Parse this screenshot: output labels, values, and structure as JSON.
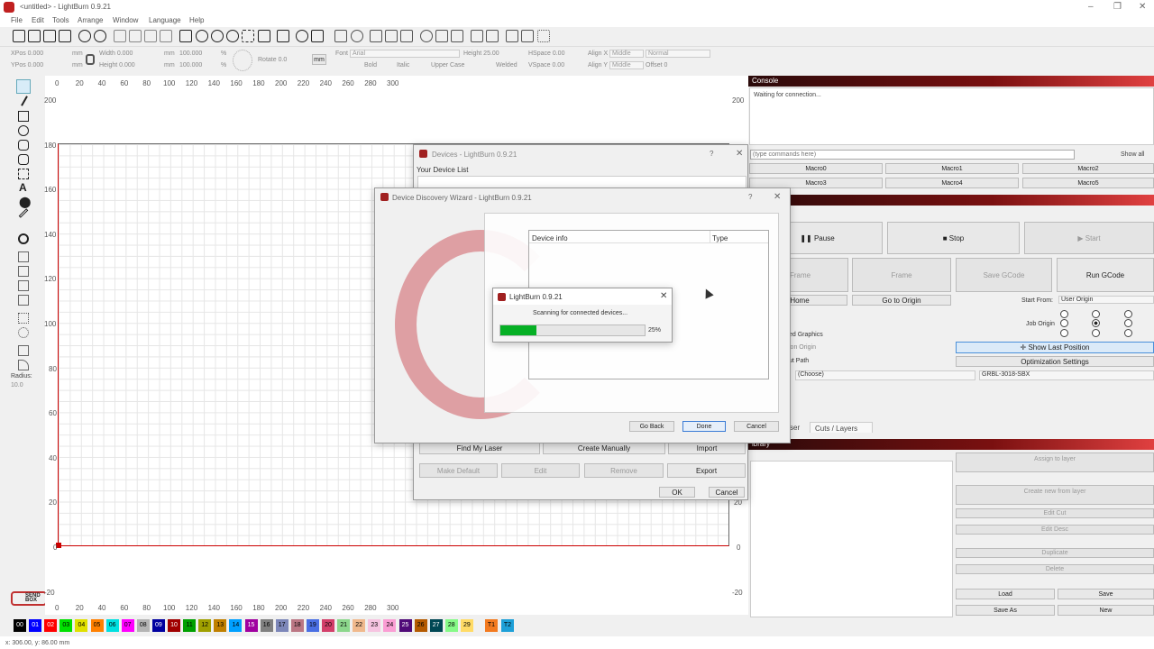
{
  "window": {
    "title": "<untitled> - LightBurn 0.9.21"
  },
  "menu": [
    "File",
    "Edit",
    "Tools",
    "Arrange",
    "Window",
    "Language",
    "Help"
  ],
  "props": {
    "xpos": "XPos 0.000",
    "ypos": "YPos 0.000",
    "width": "Width 0.000",
    "height": "Height 0.000",
    "pct1": "100.000",
    "pct2": "100.000",
    "mm": "mm",
    "rotate": "Rotate 0.0",
    "unit_btn": "mm",
    "font_label": "Font",
    "font": "Arial",
    "text_height": "Height 25.00",
    "hspace": "HSpace 0.00",
    "vspace": "VSpace 0.00",
    "alignx": "Align X",
    "aligny": "Align Y",
    "middle1": "Middle",
    "middle2": "Middle",
    "normal": "Normal",
    "offset": "Offset 0",
    "bold": "Bold",
    "italic": "Italic",
    "upper": "Upper Case",
    "welded": "Welded"
  },
  "ruler": {
    "x": [
      "0",
      "20",
      "40",
      "60",
      "80",
      "100",
      "120",
      "140",
      "160",
      "180",
      "200",
      "220",
      "240",
      "260",
      "280",
      "300"
    ],
    "y": [
      "200",
      "180",
      "160",
      "140",
      "120",
      "100",
      "80",
      "60",
      "40",
      "20",
      "0",
      "-20"
    ],
    "right_y": [
      "200",
      "20",
      "0",
      "-20"
    ]
  },
  "lefttools": {
    "radius_label": "Radius:",
    "radius_value": "10.0"
  },
  "logo": "SEND BOX",
  "palette": [
    {
      "l": "00",
      "c": "#000000",
      "t": "#ffffff"
    },
    {
      "l": "01",
      "c": "#0000ff",
      "t": "#ffffff"
    },
    {
      "l": "02",
      "c": "#ff0000",
      "t": "#ffffff"
    },
    {
      "l": "03",
      "c": "#00e000",
      "t": "#000"
    },
    {
      "l": "04",
      "c": "#e0e000",
      "t": "#000"
    },
    {
      "l": "05",
      "c": "#ff8000",
      "t": "#000"
    },
    {
      "l": "06",
      "c": "#00e0e0",
      "t": "#000"
    },
    {
      "l": "07",
      "c": "#ff00ff",
      "t": "#000"
    },
    {
      "l": "08",
      "c": "#b4b4b4",
      "t": "#000"
    },
    {
      "l": "09",
      "c": "#0000a0",
      "t": "#ffffff"
    },
    {
      "l": "10",
      "c": "#a00000",
      "t": "#ffffff"
    },
    {
      "l": "11",
      "c": "#00a000",
      "t": "#000"
    },
    {
      "l": "12",
      "c": "#a0a000",
      "t": "#000"
    },
    {
      "l": "13",
      "c": "#c08000",
      "t": "#000"
    },
    {
      "l": "14",
      "c": "#00a0ff",
      "t": "#000"
    },
    {
      "l": "15",
      "c": "#a000a0",
      "t": "#ffffff"
    },
    {
      "l": "16",
      "c": "#808080",
      "t": "#000"
    },
    {
      "l": "17",
      "c": "#7d87b9",
      "t": "#000"
    },
    {
      "l": "18",
      "c": "#bb7784",
      "t": "#000"
    },
    {
      "l": "19",
      "c": "#4a6fe3",
      "t": "#000"
    },
    {
      "l": "20",
      "c": "#d33f6a",
      "t": "#000"
    },
    {
      "l": "21",
      "c": "#8cd78c",
      "t": "#000"
    },
    {
      "l": "22",
      "c": "#f0b98d",
      "t": "#000"
    },
    {
      "l": "23",
      "c": "#f6c4e1",
      "t": "#000"
    },
    {
      "l": "24",
      "c": "#fa9ed4",
      "t": "#000"
    },
    {
      "l": "25",
      "c": "#500a78",
      "t": "#ffffff"
    },
    {
      "l": "26",
      "c": "#b45a00",
      "t": "#000"
    },
    {
      "l": "27",
      "c": "#004754",
      "t": "#ffffff"
    },
    {
      "l": "28",
      "c": "#86fa88",
      "t": "#000"
    },
    {
      "l": "29",
      "c": "#ffdb66",
      "t": "#000"
    },
    {
      "l": "T1",
      "c": "#f37a1f",
      "t": "#000"
    },
    {
      "l": "T2",
      "c": "#1ea0d8",
      "t": "#000"
    }
  ],
  "status": "x: 306.00, y: 86.00 mm",
  "console": {
    "title": "Console",
    "text": "Waiting for connection...",
    "placeholder": "(type commands here)",
    "showall": "Show all",
    "macros": [
      "Macro0",
      "Macro1",
      "Macro2",
      "Macro3",
      "Macro4",
      "Macro5"
    ]
  },
  "laser": {
    "pause": "Pause",
    "stop": "Stop",
    "start": "Start",
    "frame1": "Frame",
    "frame2": "Frame",
    "savegcode": "Save GCode",
    "rungcode": "Run GCode",
    "home": "Home",
    "gotoorigin": "Go to Origin",
    "startfrom": "Start From:",
    "startfrom_value": "User Origin",
    "joborigin": "Job Origin",
    "graphics": "ed Graphics",
    "origin": "ion Origin",
    "cutpath": "ut Path",
    "showlast": "Show Last Position",
    "optsettings": "Optimization Settings",
    "choose": "(Choose)",
    "device": "GRBL-3018-SBX",
    "tab1": "ser",
    "tab2": "Cuts / Layers"
  },
  "library": {
    "title": "ibrary",
    "assign": "Assign to layer",
    "create": "Create new from layer",
    "editcut": "Edit Cut",
    "editdesc": "Edit Desc",
    "duplicate": "Duplicate",
    "delete": "Delete",
    "load": "Load",
    "save": "Save",
    "saveas": "Save As",
    "new": "New"
  },
  "devices": {
    "title": "Devices - LightBurn 0.9.21",
    "list_label": "Your Device List",
    "find": "Find My Laser",
    "create": "Create Manually",
    "import": "Import",
    "makedefault": "Make Default",
    "edit": "Edit",
    "remove": "Remove",
    "export": "Export",
    "ok": "OK",
    "cancel": "Cancel"
  },
  "wizard": {
    "title": "Device Discovery Wizard - LightBurn 0.9.21",
    "col_info": "Device info",
    "col_type": "Type",
    "back": "Go Back",
    "done": "Done",
    "cancel": "Cancel"
  },
  "progress": {
    "title": "LightBurn 0.9.21",
    "text": "Scanning for connected devices...",
    "value": 25,
    "label": "25%"
  }
}
